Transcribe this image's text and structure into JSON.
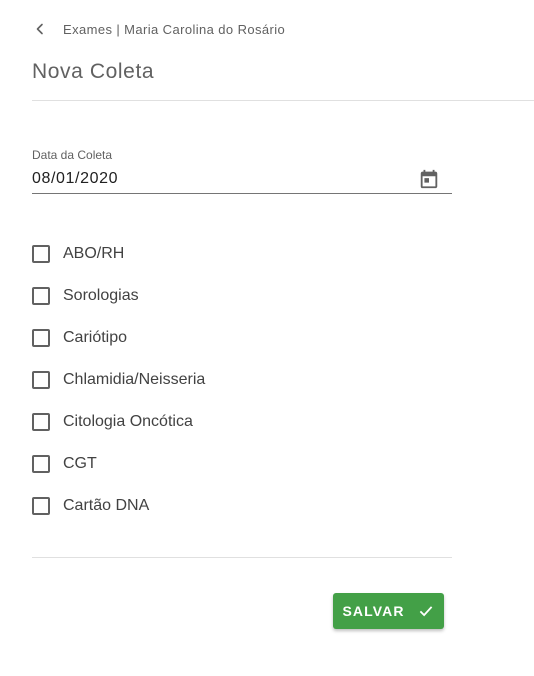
{
  "breadcrumb": {
    "text": "Exames | Maria Carolina do Rosário",
    "icon": "chevron-left-icon"
  },
  "page": {
    "title": "Nova Coleta"
  },
  "date_field": {
    "label": "Data da Coleta",
    "value": "08/01/2020",
    "icon": "calendar-icon"
  },
  "exams": [
    {
      "label": "ABO/RH",
      "checked": false
    },
    {
      "label": "Sorologias",
      "checked": false
    },
    {
      "label": "Cariótipo",
      "checked": false
    },
    {
      "label": "Chlamidia/Neisseria",
      "checked": false
    },
    {
      "label": "Citologia Oncótica",
      "checked": false
    },
    {
      "label": "CGT",
      "checked": false
    },
    {
      "label": "Cartão DNA",
      "checked": false
    }
  ],
  "actions": {
    "save_label": "SALVAR",
    "save_icon": "check-icon",
    "save_color": "#43a047"
  }
}
